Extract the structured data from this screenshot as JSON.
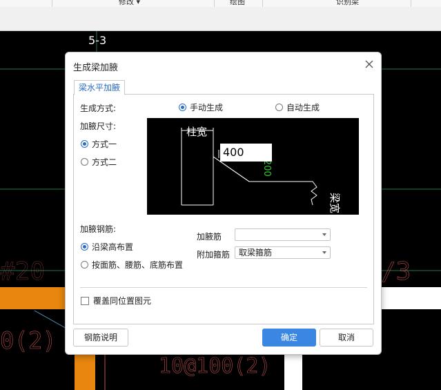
{
  "ribbon": {
    "items": [
      "修改",
      "绘图",
      "识别梁"
    ],
    "dropdown_arrow": "▾"
  },
  "background": {
    "grid_label": "5-3",
    "texts": [
      "#20",
      "/3",
      "0(2)",
      "10@100(2)"
    ]
  },
  "dialog": {
    "title": "生成梁加腋",
    "tab_label": "梁水平加腋",
    "generation_mode_label": "生成方式:",
    "generation_options": [
      "手动生成",
      "自动生成"
    ],
    "generation_selected": "手动生成",
    "size_label": "加腋尺寸:",
    "size_options": [
      "方式一",
      "方式二"
    ],
    "size_selected": "方式一",
    "preview": {
      "column_width_label": "柱宽",
      "input_value": "400",
      "green_value": "200",
      "beam_width_label": "梁宽"
    },
    "rebar_label": "加腋钢筋:",
    "rebar_options": [
      "沿梁高布置",
      "按面筋、腰筋、底筋布置"
    ],
    "rebar_selected": "沿梁高布置",
    "haunch_bar_label": "加腋筋",
    "haunch_bar_value": "",
    "stirrup_label": "附加箍筋",
    "stirrup_value": "取梁箍筋",
    "overwrite_label": "覆盖同位置图元",
    "overwrite_checked": false,
    "buttons": {
      "help": "钢筋说明",
      "ok": "确定",
      "cancel": "取消"
    }
  },
  "colors": {
    "accent": "#3a86e0",
    "tab_text": "#2b6cc4",
    "cad_bg": "#000000",
    "cad_red": "#c85050",
    "cad_orange": "#e8860f",
    "preview_green": "#32c832"
  }
}
